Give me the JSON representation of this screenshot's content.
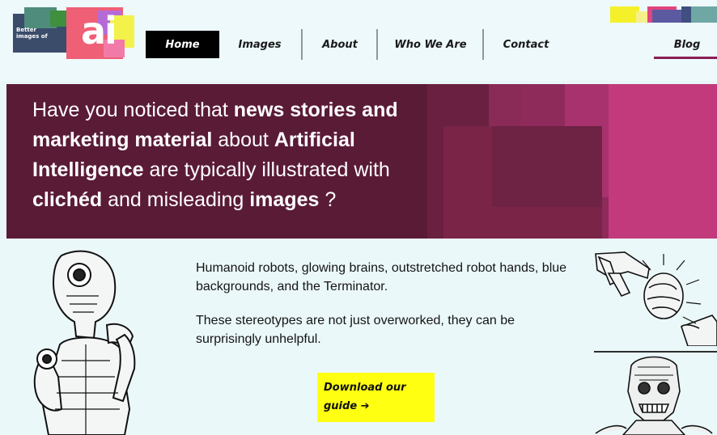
{
  "logo": {
    "line1": "Better",
    "line2": "images of",
    "mark": "ai"
  },
  "nav": {
    "items": [
      {
        "label": "Home",
        "active": true
      },
      {
        "label": "Images"
      },
      {
        "label": "About"
      },
      {
        "label": "Who We Are"
      },
      {
        "label": "Contact"
      },
      {
        "label": "Blog"
      }
    ]
  },
  "hero": {
    "segments": [
      {
        "text": "Have you noticed that ",
        "bold": false
      },
      {
        "text": "news stories and marketing material",
        "bold": true
      },
      {
        "text": " about ",
        "bold": false
      },
      {
        "text": "Artificial Intelligence",
        "bold": true
      },
      {
        "text": " are typically illustrated with ",
        "bold": false
      },
      {
        "text": "clichéd",
        "bold": true
      },
      {
        "text": " and misleading ",
        "bold": false
      },
      {
        "text": "images",
        "bold": true
      },
      {
        "text": " ?",
        "bold": false
      }
    ]
  },
  "content": {
    "paragraph1": "Humanoid robots, glowing brains, outstretched robot hands, blue backgrounds, and the Terminator.",
    "paragraph2": "These stereotypes are not just overworked, they can be surprisingly unhelpful.",
    "download_label": "Download our guide ➔"
  },
  "images": {
    "left": "thinking-robot-illustration",
    "right_top": "robot-hand-brain-illustration",
    "right_bottom": "terminator-illustration"
  },
  "colors": {
    "background": "#e9f7f9",
    "hero": "#5a1b37",
    "accent": "#8a1d55",
    "button": "#ffff12",
    "nav_active": "#000000"
  }
}
